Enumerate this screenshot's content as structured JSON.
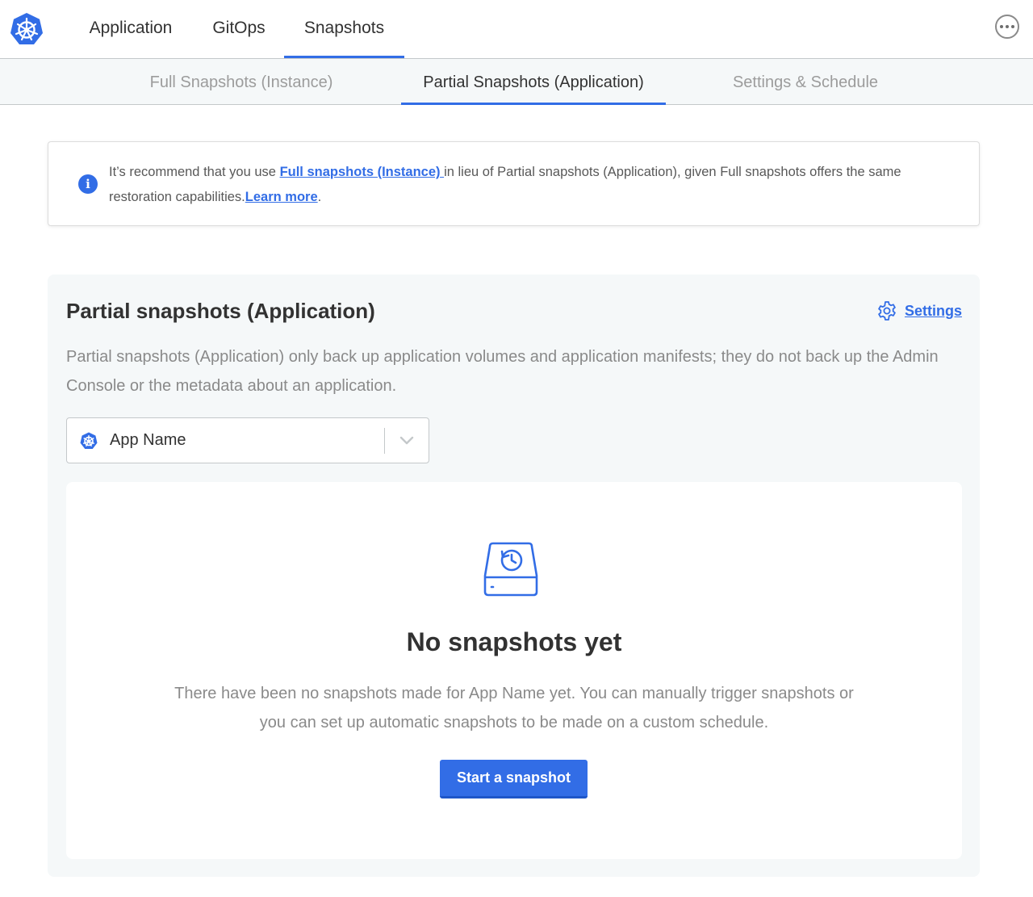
{
  "colors": {
    "accent": "#326de6",
    "muted_text": "#8a8a8a",
    "card_bg": "#f5f8f9"
  },
  "top_nav": {
    "logo_icon": "kubernetes-helm-icon",
    "items": [
      {
        "label": "Application"
      },
      {
        "label": "GitOps"
      },
      {
        "label": "Snapshots",
        "active": true
      }
    ],
    "more_icon": "more-horizontal-icon"
  },
  "sub_nav": {
    "items": [
      {
        "label": "Full Snapshots (Instance)"
      },
      {
        "label": "Partial Snapshots (Application)",
        "active": true
      },
      {
        "label": "Settings & Schedule"
      }
    ]
  },
  "banner": {
    "icon": "info-icon",
    "text_before": "It’s recommend that you use ",
    "link_full": "Full snapshots (Instance) ",
    "text_middle": "in lieu of Partial snapshots (Application), given Full snapshots offers the same restoration capabilities.",
    "link_learn": "Learn more",
    "text_after": "."
  },
  "card": {
    "title": "Partial snapshots (Application)",
    "settings_label": "Settings",
    "settings_icon": "gear-icon",
    "description": "Partial snapshots (Application) only back up application volumes and application manifests; they do not back up the Admin Console or the metadata about an application.",
    "app_select": {
      "value": "App Name",
      "icon": "kubernetes-helm-icon",
      "chevron": "chevron-down-icon"
    },
    "empty_state": {
      "icon": "snapshot-drive-icon",
      "title": "No snapshots yet",
      "description": "There have been no snapshots made for App Name yet. You can manually trigger snapshots or you can set up automatic snapshots to be made on a custom schedule.",
      "button_label": "Start a snapshot"
    }
  }
}
